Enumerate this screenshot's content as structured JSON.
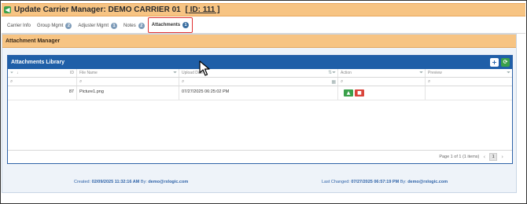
{
  "header": {
    "title": "Update Carrier Manager: DEMO CARRIER 01",
    "id_link": "[ ID: 111 ]",
    "back_icon": "arrow-left-icon"
  },
  "tabs": [
    {
      "label": "Carrier Info",
      "badge": ""
    },
    {
      "label": "Group Mgmt",
      "badge": "2"
    },
    {
      "label": "Adjuster Mgmt",
      "badge": "1"
    },
    {
      "label": "Notes",
      "badge": "2"
    },
    {
      "label": "Attachments",
      "badge": "1",
      "active": true
    }
  ],
  "section": {
    "title": "Attachment Manager"
  },
  "library": {
    "title": "Attachments Library",
    "add_icon": "plus-icon",
    "refresh_icon": "refresh-icon",
    "columns": [
      "ID",
      "File Name",
      "Upload Date",
      "Action",
      "Preview"
    ],
    "sort_indicator": "↓",
    "rows": [
      {
        "id": "87",
        "file_name": "Picture1.png",
        "upload_date": "07/27/2025 06:25:02 PM"
      }
    ],
    "pager": {
      "summary": "Page 1 of 1 (1 items)",
      "current_page": "1"
    }
  },
  "footer": {
    "created_label": "Created:",
    "created_value": "02/09/2025 11:32:16 AM",
    "created_by_label": "By:",
    "created_by": "demo@rxlogic.com",
    "changed_label": "Last Changed:",
    "changed_value": "07/27/2025 06:57:19 PM",
    "changed_by_label": "By:",
    "changed_by": "demo@rxlogic.com"
  },
  "colors": {
    "header_bg": "#f7c483",
    "library_header_bg": "#1f5fa8",
    "active_tab_border": "#e03030",
    "download_button": "#3aa04a",
    "delete_button": "#d9453c"
  }
}
